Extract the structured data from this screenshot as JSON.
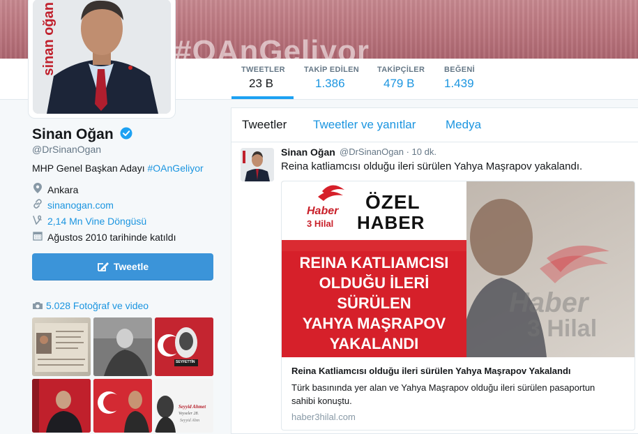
{
  "banner": {
    "hashtag": "#OAnGeliyor"
  },
  "nav": {
    "items": [
      {
        "label": "TWEETLER",
        "value": "23 B"
      },
      {
        "label": "TAKİP EDİLEN",
        "value": "1.386"
      },
      {
        "label": "TAKİPÇİLER",
        "value": "479 B"
      },
      {
        "label": "BEĞENİ",
        "value": "1.439"
      }
    ]
  },
  "avatar": {
    "brand": "sinan oğan"
  },
  "profile": {
    "name": "Sinan Oğan",
    "handle": "@DrSinanOgan",
    "bio_text": "MHP Genel Başkan Adayı ",
    "bio_hashtag": "#OAnGeliyor",
    "location": "Ankara",
    "website": "sinanogan.com",
    "vine": "2,14 Mn Vine Döngüsü",
    "joined": "Ağustos 2010 tarihinde katıldı",
    "tweet_button": "Tweetle",
    "photos_label": "5.028 Fotoğraf ve video"
  },
  "timeline": {
    "tabs": [
      "Tweetler",
      "Tweetler ve yanıtlar",
      "Medya"
    ],
    "tweet": {
      "name": "Sinan Oğan",
      "handle": "@DrSinanOgan · 10 dk.",
      "text": "Reina katliamcısı olduğu ileri sürülen Yahya Maşrapov yakalandı.",
      "card": {
        "logo_top": "Haber",
        "logo_bottom": "3 Hilal",
        "badge_line1": "ÖZEL",
        "badge_line2": "HABER",
        "headline": [
          "REINA KATLIAMCISI",
          "OLDUĞU İLERİ",
          "SÜRÜLEN",
          "YAHYA MAŞRAPOV",
          "YAKALANDI"
        ],
        "watermark_top": "Haber",
        "watermark_bottom": "3 Hilal",
        "title": "Reina Katliamcısı olduğu ileri sürülen Yahya Maşrapov Yakalandı",
        "description": "Türk basınında yer alan ve Yahya Maşrapov olduğu ileri sürülen pasaportun sahibi konuştu.",
        "domain": "haber3hilal.com"
      }
    }
  },
  "thumbs": {
    "labels": [
      "SEYFETTİN",
      "Seyyid Ahmet",
      "Veyseler 28.",
      "Seyyid Ahm"
    ]
  },
  "colors": {
    "link": "#1b95e0",
    "button": "#3b94d9",
    "accent_red": "#d6202a"
  }
}
